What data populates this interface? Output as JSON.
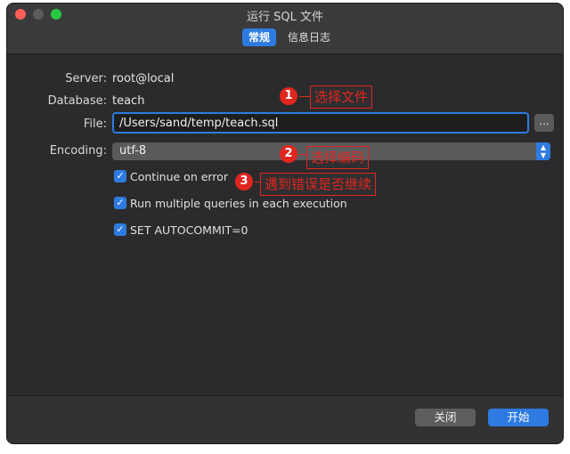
{
  "window": {
    "title": "运行 SQL 文件"
  },
  "tabs": [
    {
      "label": "常规"
    },
    {
      "label": "信息日志"
    }
  ],
  "form": {
    "server_label": "Server:",
    "server_value": "root@local",
    "database_label": "Database:",
    "database_value": "teach",
    "file_label": "File:",
    "file_value": "/Users/sand/temp/teach.sql",
    "browse_label": "...",
    "encoding_label": "Encoding:",
    "encoding_value": "utf-8"
  },
  "options": [
    {
      "label": "Continue on error",
      "checked": true
    },
    {
      "label": "Run multiple queries in each execution",
      "checked": true
    },
    {
      "label": "SET AUTOCOMMIT=0",
      "checked": true
    }
  ],
  "annotations": [
    {
      "number": "1",
      "text": "选择文件"
    },
    {
      "number": "2",
      "text": "选择编码"
    },
    {
      "number": "3",
      "text": "遇到错误是否继续"
    }
  ],
  "buttons": {
    "close": "关闭",
    "start": "开始"
  },
  "colors": {
    "accent": "#2d7be0",
    "annotation": "#e0261f",
    "window_bg": "#2b2b2d"
  }
}
